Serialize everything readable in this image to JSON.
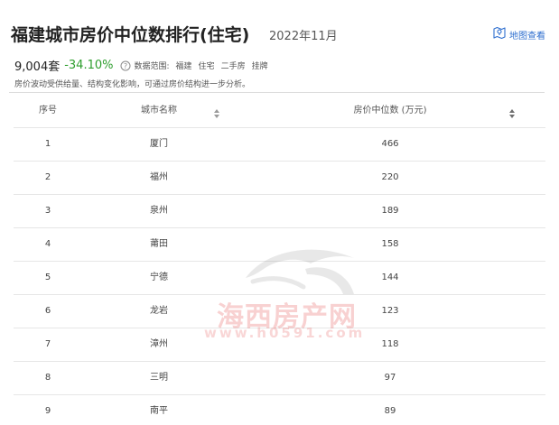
{
  "header": {
    "title": "福建城市房价中位数排行(住宅)",
    "period": "2022年11月",
    "map_link_label": "地图查看",
    "map_icon": "map-pin-icon"
  },
  "summary": {
    "count": "9,004套",
    "change": "-34.10%",
    "change_color": "#2e9e2e",
    "scope_label": "数据范围:",
    "scope_tags": [
      "福建",
      "住宅",
      "二手房",
      "挂牌"
    ],
    "note": "房价波动受供给量、结构变化影响，可通过房价结构进一步分析。"
  },
  "table": {
    "headers": [
      "序号",
      "城市名称",
      "房价中位数 (万元)"
    ],
    "rows": [
      {
        "rank": "1",
        "city": "厦门",
        "price": "466"
      },
      {
        "rank": "2",
        "city": "福州",
        "price": "220"
      },
      {
        "rank": "3",
        "city": "泉州",
        "price": "189"
      },
      {
        "rank": "4",
        "city": "莆田",
        "price": "158"
      },
      {
        "rank": "5",
        "city": "宁德",
        "price": "144"
      },
      {
        "rank": "6",
        "city": "龙岩",
        "price": "123"
      },
      {
        "rank": "7",
        "city": "漳州",
        "price": "118"
      },
      {
        "rank": "8",
        "city": "三明",
        "price": "97"
      },
      {
        "rank": "9",
        "city": "南平",
        "price": "89"
      }
    ]
  },
  "watermark": {
    "brand": "海西房产网",
    "url": "www.h0591.com"
  }
}
